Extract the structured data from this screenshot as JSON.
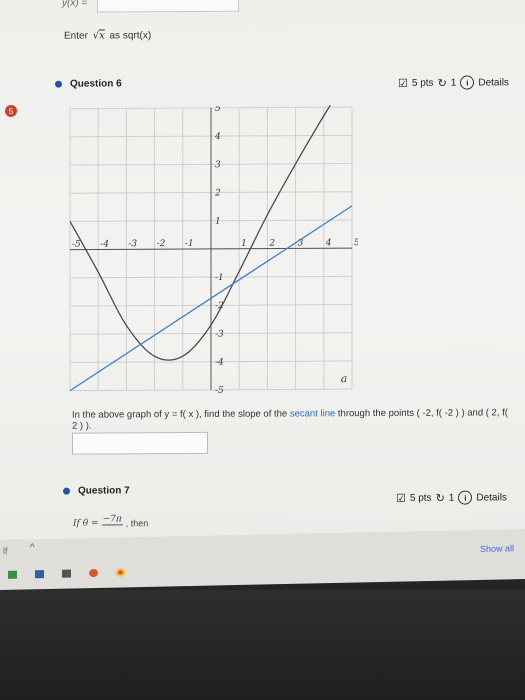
{
  "top": {
    "label": "y(x) ="
  },
  "hint": {
    "prefix": "Enter",
    "radicand": "x",
    "suffix": "as sqrt(x)"
  },
  "marker": {
    "text": "5"
  },
  "q6": {
    "title": "Question 6",
    "points": "5 pts",
    "tries": "1",
    "details": "Details",
    "prompt_before": "In the above graph of y = f( x ), find the slope of the",
    "prompt_link": "secant line",
    "prompt_after": "through the points ( -2, f( -2 ) ) and ( 2, f( 2 ) )."
  },
  "q7": {
    "title": "Question 7",
    "points": "5 pts",
    "tries": "1",
    "details": "Details",
    "lhs": "If θ =",
    "numerator": "−7π",
    "then": ", then"
  },
  "taskbar": {
    "left_text": "lf",
    "show_all": "Show all"
  },
  "chart_data": {
    "type": "line",
    "xlim": [
      -5,
      5
    ],
    "ylim": [
      -5,
      5
    ],
    "grid": true,
    "x_ticks": [
      -5,
      -4,
      -3,
      -2,
      -1,
      1,
      2,
      3,
      4,
      5
    ],
    "y_ticks": [
      5,
      4,
      3,
      2,
      1,
      -1,
      -2,
      -3,
      -4,
      -5
    ],
    "annotation": "a",
    "series": [
      {
        "x": [
          -5,
          -4,
          -3,
          -2,
          -1,
          0,
          1,
          2,
          3,
          4,
          5
        ],
        "y": [
          1,
          -0.8,
          -2.7,
          -3.8,
          -3.8,
          -2.7,
          -0.8,
          1.2,
          3,
          4.7,
          6.3
        ],
        "color": "#4a4a4a"
      },
      {
        "x": [
          -5,
          5
        ],
        "y": [
          -5,
          1.5
        ],
        "color": "#3b7fd6"
      }
    ]
  }
}
